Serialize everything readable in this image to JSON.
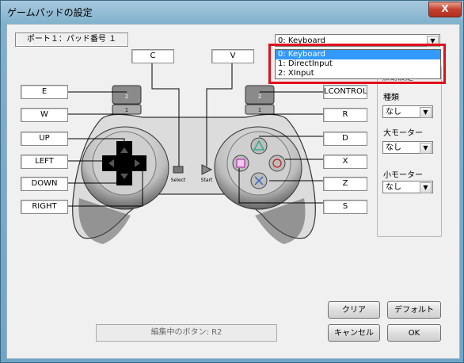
{
  "window": {
    "title": "ゲームパッドの設定",
    "close": "X"
  },
  "port": "ポート１：パッド番号 １",
  "top_keys": {
    "c": "C",
    "v": "V"
  },
  "left_keys": [
    {
      "id": "e",
      "label": "E"
    },
    {
      "id": "w",
      "label": "W"
    },
    {
      "id": "up",
      "label": "UP"
    },
    {
      "id": "left",
      "label": "LEFT"
    },
    {
      "id": "down",
      "label": "DOWN"
    },
    {
      "id": "right",
      "label": "RIGHT"
    }
  ],
  "right_keys": [
    {
      "id": "lcontrol",
      "label": "LCONTROL"
    },
    {
      "id": "r",
      "label": "R"
    },
    {
      "id": "d",
      "label": "D"
    },
    {
      "id": "x",
      "label": "X"
    },
    {
      "id": "z",
      "label": "Z"
    },
    {
      "id": "s",
      "label": "S"
    }
  ],
  "device_select": {
    "value": "0: Keyboard",
    "options": [
      "0: Keyboard",
      "1: DirectInput",
      "2: XInput"
    ],
    "selected_index": 0
  },
  "vibration": {
    "group_label": "振動設定",
    "type_label": "種類",
    "type_value": "なし",
    "large_motor_label": "大モーター",
    "large_motor_value": "なし",
    "small_motor_label": "小モーター",
    "small_motor_value": "なし"
  },
  "pad": {
    "select": "Select",
    "start": "Start",
    "btn2_left": "2",
    "btn1_left": "1",
    "btn2_right": "2",
    "btn1_right": "1"
  },
  "buttons": {
    "clear": "クリア",
    "default": "デフォルト",
    "cancel": "キャンセル",
    "ok": "OK"
  },
  "editing": "編集中のボタン: R2",
  "colors": {
    "highlight": "#3399ff",
    "callout": "#e0101a",
    "pad_body": "#d8d8d8"
  }
}
